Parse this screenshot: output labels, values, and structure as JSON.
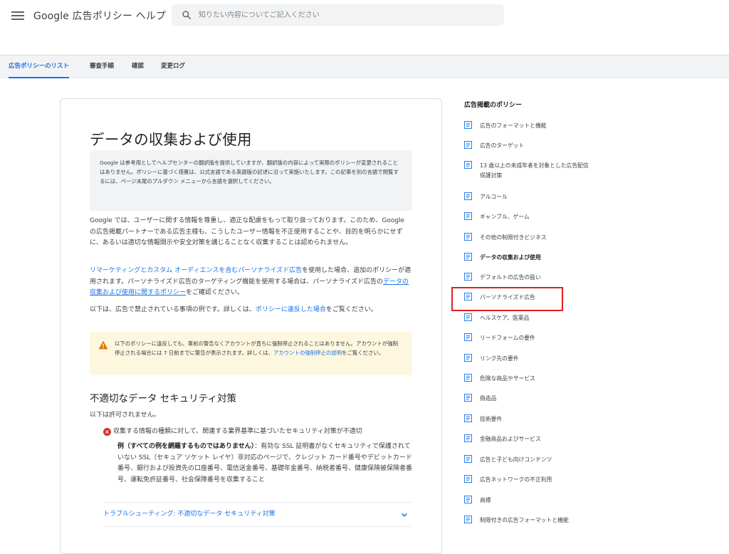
{
  "header": {
    "menu_icon": "menu-icon",
    "title": "Google 広告ポリシー ヘルプ",
    "search": {
      "placeholder": "知りたい内容についてご記入ください",
      "value": ""
    }
  },
  "tabs": [
    {
      "label": "広告ポリシーのリスト",
      "active": true
    },
    {
      "label": "審査手順",
      "active": false
    },
    {
      "label": "確認",
      "active": false
    },
    {
      "label": "変更ログ",
      "active": false
    }
  ],
  "article": {
    "title": "データの収集および使用",
    "translation_notice": "Google は参考用としてヘルプセンターの翻訳版を提供していますが、翻訳版の内容によって実際のポリシーが変更されることはありません。ポリシーに基づく措置は、公式言語である英語版の記述に沿って実施いたします。この記事を別の言語で閲覧するには、ページ末尾のプルダウン メニューから言語を選択してください。",
    "intro": "Google では、ユーザーに関する情報を尊重し、適正な配慮をもって取り扱っております。このため、Google の広告掲載パートナーである広告主様も、こうしたユーザー情報を不正使用することや、目的を明らかにせずに、あるいは適切な情報開示や安全対策を講じることなく収集することは認められません。",
    "remarketing": {
      "link1": "リマーケティングとカスタム オーディエンスを含むパーソナライズド広告",
      "text1": "を使用した場合、追加のポリシーが適用されます。パーソナライズド広告のターゲティング機能を使用する場合は、パーソナライズド広告の",
      "link2": "データの収集および使用に関するポリシー",
      "text2": "をご確認ください。"
    },
    "examples_intro": {
      "text1": "以下は、広告で禁止されている事項の例です。詳しくは、",
      "link": "ポリシーに違反した場合",
      "text2": "をご覧ください。"
    },
    "warning": {
      "text1": "以下のポリシーに違反しても、事前の警告なくアカウントが直ちに強制停止されることはありません。アカウントが強制停止される場合には 7 日前までに警告が表示されます。詳しくは、",
      "link": "アカウントの強制停止の説明",
      "text2": "をご覧ください。"
    },
    "section_heading": "不適切なデータ セキュリティ対策",
    "not_allowed": "以下は許可されません。",
    "bullet": "収集する情報の種類に対して、関連する業界基準に基づいたセキュリティ対策が不適切",
    "example_label": "例（すべての例を網羅するものではありません）",
    "example_text": "：有効な SSL 証明書がなくセキュリティで保護されていない SSL（セキュア ソケット レイヤ）非対応のページで、クレジット カード番号やデビットカード番号、銀行および投資先の口座番号、電信送金番号、基礎年金番号、納税者番号、健康保険被保険者番号、運転免許証番号、社会保障番号を収集すること",
    "troubleshoot": "トラブルシューティング: 不適切なデータ セキュリティ対策"
  },
  "sidebar": {
    "title": "広告掲載のポリシー",
    "items": [
      {
        "label": "広告のフォーマットと機能"
      },
      {
        "label": "広告のターゲット"
      },
      {
        "label": "13 歳以上の未成年者を対象とした広告配信保護対策"
      },
      {
        "label": "アルコール"
      },
      {
        "label": "ギャンブル、ゲーム"
      },
      {
        "label": "その他の制限付きビジネス"
      },
      {
        "label": "データの収集および使用"
      },
      {
        "label": "デフォルトの広告の扱い"
      },
      {
        "label": "パーソナライズド広告"
      },
      {
        "label": "ヘルスケア、医薬品"
      },
      {
        "label": "リードフォームの要件"
      },
      {
        "label": "リンク先の要件"
      },
      {
        "label": "危険な商品やサービス"
      },
      {
        "label": "偽造品"
      },
      {
        "label": "技術要件"
      },
      {
        "label": "金融商品およびサービス"
      },
      {
        "label": "広告と子ども向けコンテンツ"
      },
      {
        "label": "広告ネットワークの不正利用"
      },
      {
        "label": "商標"
      },
      {
        "label": "制限付きの広告フォーマットと機能"
      }
    ]
  },
  "colors": {
    "link": "#1a73e8",
    "highlight": "#e02020",
    "warning_bg": "#fef7e0",
    "notice_bg": "#f1f3f4"
  }
}
